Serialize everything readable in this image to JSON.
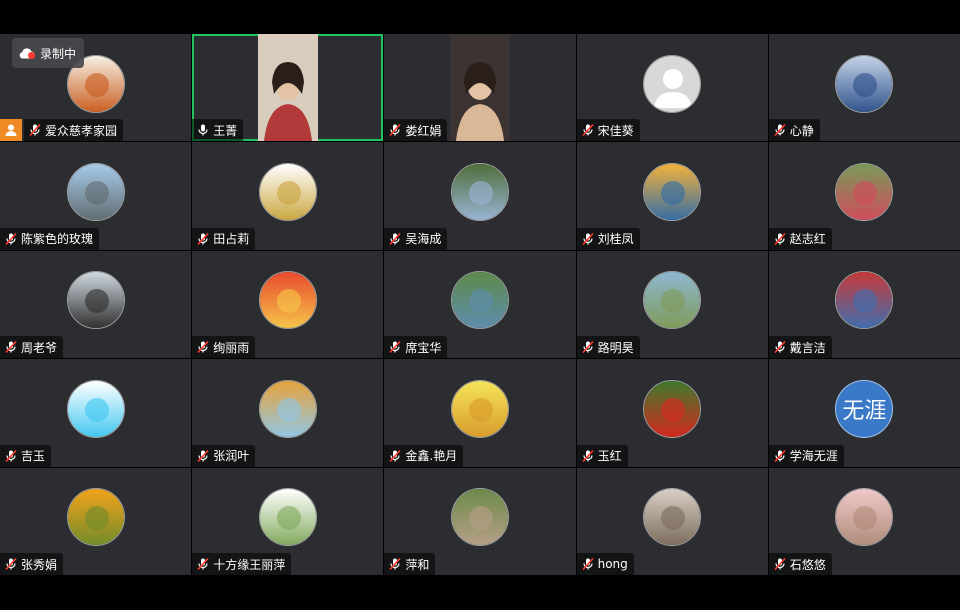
{
  "recording": {
    "label": "录制中",
    "icon": "cloud-record-icon"
  },
  "participants": [
    {
      "name": "爱众慈孝家园",
      "muted": true,
      "host": true,
      "avatar": "logo-avatar",
      "colors": [
        "#f6efe2",
        "#c85a1c"
      ]
    },
    {
      "name": "王菁",
      "muted": false,
      "active": true,
      "video": true,
      "colors": [
        "#d9ccbd",
        "#b33a3a"
      ]
    },
    {
      "name": "娄红娟",
      "muted": true,
      "video": true,
      "colors": [
        "#3b3432",
        "#d8b896"
      ]
    },
    {
      "name": "宋佳葵",
      "muted": true,
      "avatar": "default-avatar",
      "colors": [
        "#d8d8d8",
        "#ffffff"
      ]
    },
    {
      "name": "心静",
      "muted": true,
      "avatar": "photo-avatar",
      "colors": [
        "#c3d3e6",
        "#2d4f8a"
      ]
    },
    {
      "name": "陈紫色的玫瑰",
      "muted": true,
      "avatar": "photo-avatar",
      "colors": [
        "#a7cbe8",
        "#5f6b6f"
      ]
    },
    {
      "name": "田占莉",
      "muted": true,
      "avatar": "photo-avatar",
      "colors": [
        "#ffffff",
        "#c9a43a"
      ]
    },
    {
      "name": "吴海成",
      "muted": true,
      "avatar": "photo-avatar",
      "colors": [
        "#4f6e3a",
        "#9bb6d9"
      ]
    },
    {
      "name": "刘桂凤",
      "muted": true,
      "avatar": "photo-avatar",
      "colors": [
        "#f3b33c",
        "#2e6ba8"
      ]
    },
    {
      "name": "赵志红",
      "muted": true,
      "avatar": "photo-avatar",
      "colors": [
        "#7a9a5a",
        "#d24a5c"
      ]
    },
    {
      "name": "周老爷",
      "muted": true,
      "avatar": "photo-avatar",
      "colors": [
        "#cfd8df",
        "#2b2b2b"
      ]
    },
    {
      "name": "绚丽雨",
      "muted": true,
      "avatar": "photo-avatar",
      "colors": [
        "#e84b2e",
        "#f6c84a"
      ]
    },
    {
      "name": "席宝华",
      "muted": true,
      "avatar": "photo-avatar",
      "colors": [
        "#5d8a4a",
        "#5f8db0"
      ]
    },
    {
      "name": "路明昊",
      "muted": true,
      "avatar": "photo-avatar",
      "colors": [
        "#8db7d0",
        "#7f9a56"
      ]
    },
    {
      "name": "戴言洁",
      "muted": true,
      "avatar": "photo-avatar",
      "colors": [
        "#c63a3a",
        "#3d6fb2"
      ]
    },
    {
      "name": "吉玉",
      "muted": true,
      "avatar": "photo-avatar",
      "colors": [
        "#ffffff",
        "#3ec6f0"
      ]
    },
    {
      "name": "张润叶",
      "muted": true,
      "avatar": "photo-avatar",
      "colors": [
        "#e8a33c",
        "#8fc7e8"
      ]
    },
    {
      "name": "金鑫.艳月",
      "muted": true,
      "avatar": "photo-avatar",
      "colors": [
        "#f5e45a",
        "#d89a2a"
      ]
    },
    {
      "name": "玉红",
      "muted": true,
      "avatar": "photo-avatar",
      "colors": [
        "#3f7a2e",
        "#d8261e"
      ]
    },
    {
      "name": "学海无涯",
      "muted": true,
      "avatar": "text-avatar",
      "avatar_text": "无涯",
      "colors": [
        "#3a78c8",
        "#3a78c8"
      ]
    },
    {
      "name": "张秀娟",
      "muted": true,
      "avatar": "photo-avatar",
      "colors": [
        "#f2a31d",
        "#6f8b2a"
      ]
    },
    {
      "name": "十方缘王丽萍",
      "muted": true,
      "avatar": "photo-avatar",
      "colors": [
        "#ffffff",
        "#7fa85a"
      ]
    },
    {
      "name": "萍和",
      "muted": true,
      "avatar": "photo-avatar",
      "colors": [
        "#6c8a4a",
        "#b8a089"
      ]
    },
    {
      "name": "hong",
      "muted": true,
      "avatar": "photo-avatar",
      "colors": [
        "#d8cfc4",
        "#7a6a5a"
      ]
    },
    {
      "name": "石悠悠",
      "muted": true,
      "avatar": "photo-avatar",
      "colors": [
        "#f0c8c8",
        "#b08a7a"
      ]
    }
  ]
}
